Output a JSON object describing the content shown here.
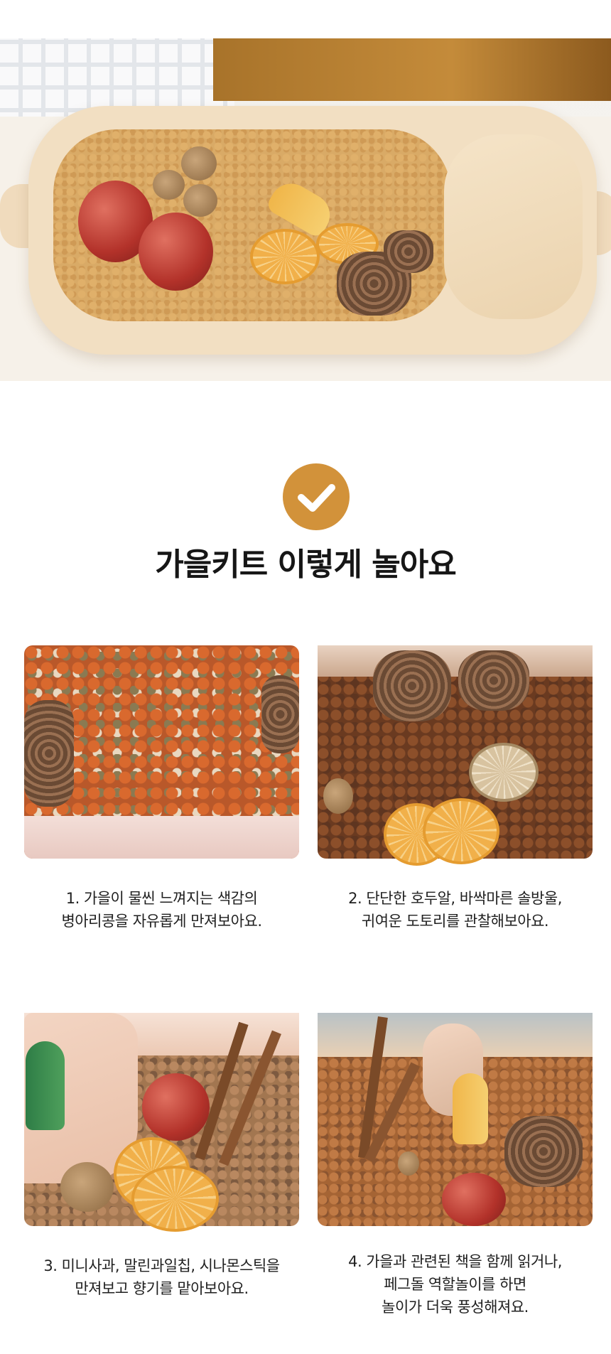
{
  "hero": {
    "alt_icon": "sensory-tray-photo"
  },
  "check_icon": "check-icon",
  "accent_color": "#d2923a",
  "title": "가을키트 이렇게 놀아요",
  "steps": [
    {
      "line1": "1. 가을이 물씬 느껴지는 색감의",
      "line2": "병아리콩을 자유롭게 만져보아요."
    },
    {
      "line1": "2. 단단한 호두알, 바싹마른 솔방울,",
      "line2": "귀여운 도토리를 관찰해보아요."
    },
    {
      "line1": "3. 미니사과, 말린과일칩, 시나몬스틱을",
      "line2": "만져보고 향기를 맡아보아요."
    },
    {
      "line1": "4. 가을과 관련된 책을 함께 읽거나,",
      "line2": "페그돌 역할놀이를 하면",
      "line3": "놀이가 더욱 풍성해져요."
    }
  ]
}
